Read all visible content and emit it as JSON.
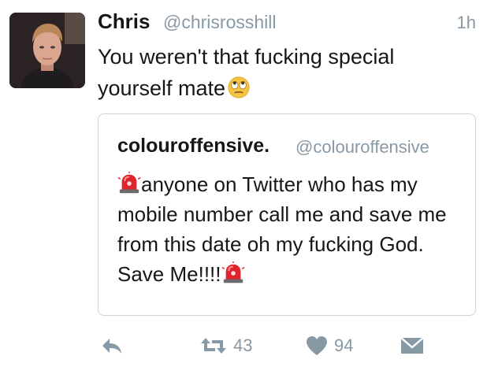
{
  "tweet": {
    "author_name": "Chris",
    "author_handle": "@chrisrosshill",
    "timestamp": "1h",
    "text": "You weren't that fucking special yourself mate",
    "emoji": "face-with-rolling-eyes-icon"
  },
  "quoted_tweet": {
    "author_name": "colouroffensive.",
    "author_handle": "@colouroffensive",
    "text": "anyone on Twitter who has my mobile number call me and save me from this date oh my fucking God. Save Me!!!!",
    "emoji": "police-siren-icon"
  },
  "actions": {
    "reply_icon": "reply-icon",
    "retweet_icon": "retweet-icon",
    "retweet_count": "43",
    "like_icon": "heart-icon",
    "like_count": "94",
    "dm_icon": "direct-message-icon"
  },
  "colors": {
    "text": "#14171a",
    "secondary": "#8899a6",
    "border": "#cdd5dc",
    "siren": "#e0242e"
  }
}
